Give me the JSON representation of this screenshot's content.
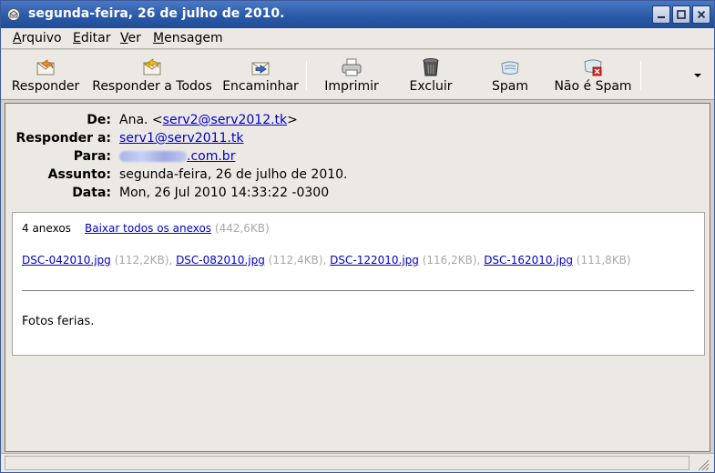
{
  "window": {
    "title": "segunda-feira, 26 de julho de 2010."
  },
  "menubar": {
    "items": [
      {
        "label_underlined": "A",
        "label_rest": "rquivo"
      },
      {
        "label_underlined": "E",
        "label_rest": "ditar"
      },
      {
        "label_underlined": "V",
        "label_rest": "er"
      },
      {
        "label_underlined": "M",
        "label_rest": "ensagem"
      }
    ]
  },
  "toolbar": {
    "buttons": [
      {
        "label": "Responder",
        "icon": "reply-icon"
      },
      {
        "label": "Responder a Todos",
        "icon": "reply-all-icon"
      },
      {
        "label": "Encaminhar",
        "icon": "forward-icon"
      },
      {
        "label": "Imprimir",
        "icon": "printer-icon"
      },
      {
        "label": "Excluir",
        "icon": "trash-icon"
      },
      {
        "label": "Spam",
        "icon": "spam-icon"
      },
      {
        "label": "Não é Spam",
        "icon": "not-spam-icon"
      }
    ],
    "overflow_icon": "chevron-down-icon"
  },
  "headers": {
    "from_label": "De:",
    "from_name": "Ana. <",
    "from_email": "serv2@serv2012.tk",
    "from_suffix": ">",
    "reply_to_label": "Responder a:",
    "reply_to_email": "serv1@serv2011.tk",
    "to_label": "Para:",
    "to_email_visible": ".com.br",
    "subject_label": "Assunto:",
    "subject": "segunda-feira, 26 de julho de 2010.",
    "date_label": "Data:",
    "date": "Mon, 26 Jul 2010 14:33:22 -0300"
  },
  "attachments": {
    "count_text": "4 anexos",
    "download_all_label": "Baixar todos os anexos",
    "total_size": "(442,6KB)",
    "files": [
      {
        "name": "DSC-042010.jpg",
        "size": "(112,2KB),"
      },
      {
        "name": "DSC-082010.jpg",
        "size": "(112,4KB),"
      },
      {
        "name": "DSC-122010.jpg",
        "size": "(116,2KB),"
      },
      {
        "name": "DSC-162010.jpg",
        "size": "(111,8KB)"
      }
    ]
  },
  "body": {
    "text": "Fotos ferias."
  }
}
